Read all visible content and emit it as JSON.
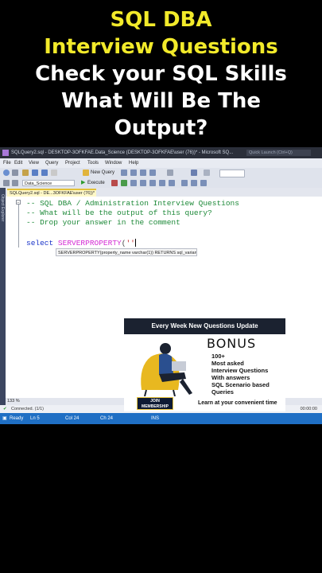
{
  "headline": {
    "line1": "SQL  DBA",
    "line2": "Interview Questions",
    "line3": "Check your SQL Skills",
    "line4": "What Will Be The",
    "line5": "Output?"
  },
  "window": {
    "title": "SQLQuery2.sql - DESKTOP-3OFKFAE.Data_Science (DESKTOP-3OFKFAE\\user (76))* - Microsoft SQ...",
    "quick_launch_placeholder": "Quick Launch (Ctrl+Q)"
  },
  "menu": [
    "File",
    "Edit",
    "View",
    "Query",
    "Project",
    "Tools",
    "Window",
    "Help"
  ],
  "toolbar": {
    "new_query": "New Query",
    "database": "Data_Science",
    "execute": "Execute"
  },
  "side_panel": "Object Explorer",
  "tab": {
    "label": "SQLQuery2.sql - DE...3OFKFAE\\user (76))*"
  },
  "editor": {
    "comment1": "-- SQL DBA / Administration Interview Questions",
    "comment2": "-- What will be the output of this query?",
    "comment3": "-- Drop your answer in the comment",
    "keyword": "select",
    "function": "SERVERPROPERTY",
    "open_paren": "(",
    "string": "''",
    "tooltip": "SERVERPROPERTY(property_name varchar(1)) RETURNS sql_variant"
  },
  "zoom": "133 %",
  "messages": {
    "connected": "Connected. (1/1)",
    "time": "00:00:00"
  },
  "status": {
    "ready": "Ready",
    "ln": "Ln 5",
    "col": "Col 24",
    "ch": "Ch 24",
    "ins": "INS"
  },
  "ad": {
    "top": "Every Week New Questions Update",
    "bonus": "BONUS",
    "items": [
      "100+",
      "Most asked",
      "Interview Questions",
      "With answers",
      "SQL Scenario based",
      "Queries"
    ],
    "join_line1": "JOIN",
    "join_line2": "MEMBERSHIP",
    "footer": "Learn at your convenient time"
  },
  "colors": {
    "headline_yellow": "#f2ea2a",
    "status_blue": "#1f6fc4",
    "comment_green": "#1f8a3a",
    "keyword_blue": "#1a34c9",
    "function_pink": "#d42ad4"
  }
}
